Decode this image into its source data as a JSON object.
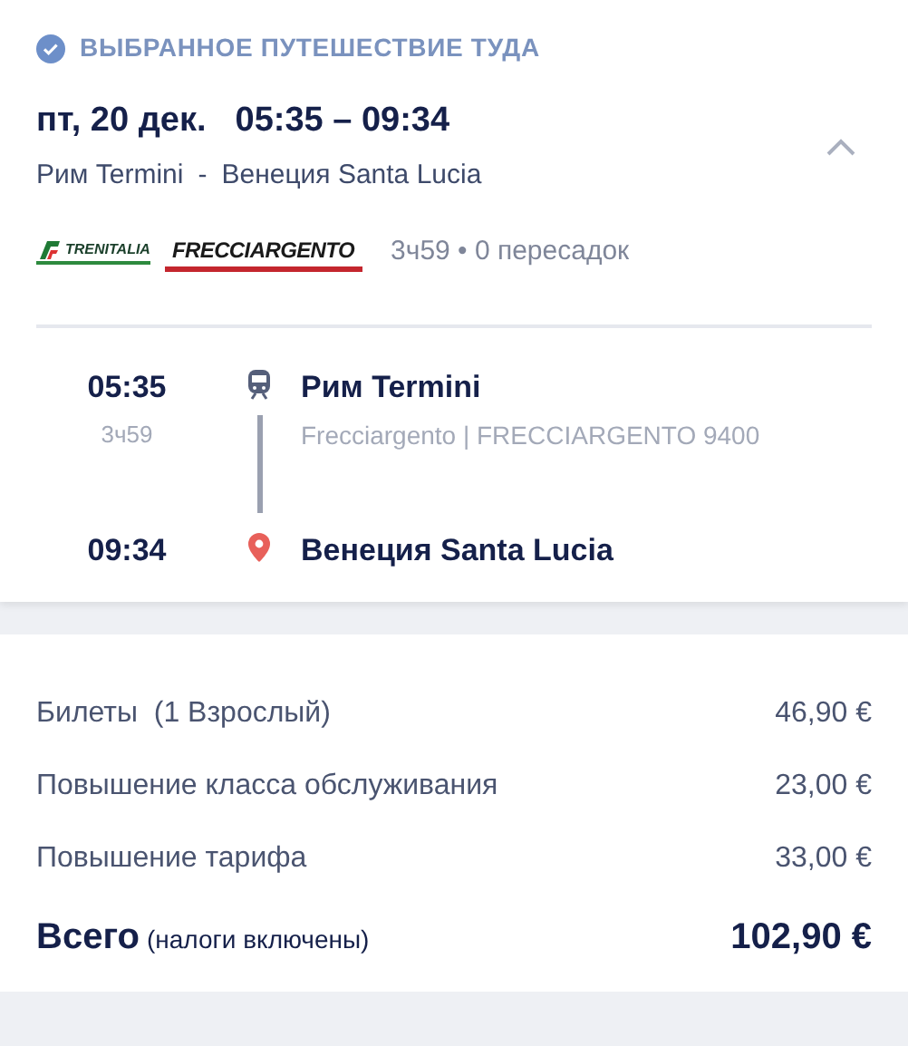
{
  "header": {
    "title": "ВЫБРАННОЕ ПУТЕШЕСТВИЕ ТУДА",
    "checked": true
  },
  "trip": {
    "date": "пт, 20 дек.",
    "times": "05:35 – 09:34",
    "route_from": "Рим Termini",
    "route_separator": "-",
    "route_to": "Венеция Santa Lucia",
    "expanded": true,
    "operator_logo": "TRENITALIA",
    "train_logo": "FRECCIARGENTO",
    "summary": "3ч59 • 0 пересадок"
  },
  "timeline": [
    {
      "kind": "departure",
      "time": "05:35",
      "duration": "3ч59",
      "station": "Рим Termini",
      "service": "Frecciargento | FRECCIARGENTO 9400"
    },
    {
      "kind": "arrival",
      "time": "09:34",
      "station": "Венеция Santa Lucia"
    }
  ],
  "prices": [
    {
      "label": "Билеты  (1 Взрослый)",
      "amount": "46,90 €"
    },
    {
      "label": "Повышение класса обслуживания",
      "amount": "23,00 €"
    },
    {
      "label": "Повышение тарифа",
      "amount": "33,00 €"
    }
  ],
  "total": {
    "label": "Всего",
    "note": "(налоги включены)",
    "amount": "102,90 €"
  }
}
